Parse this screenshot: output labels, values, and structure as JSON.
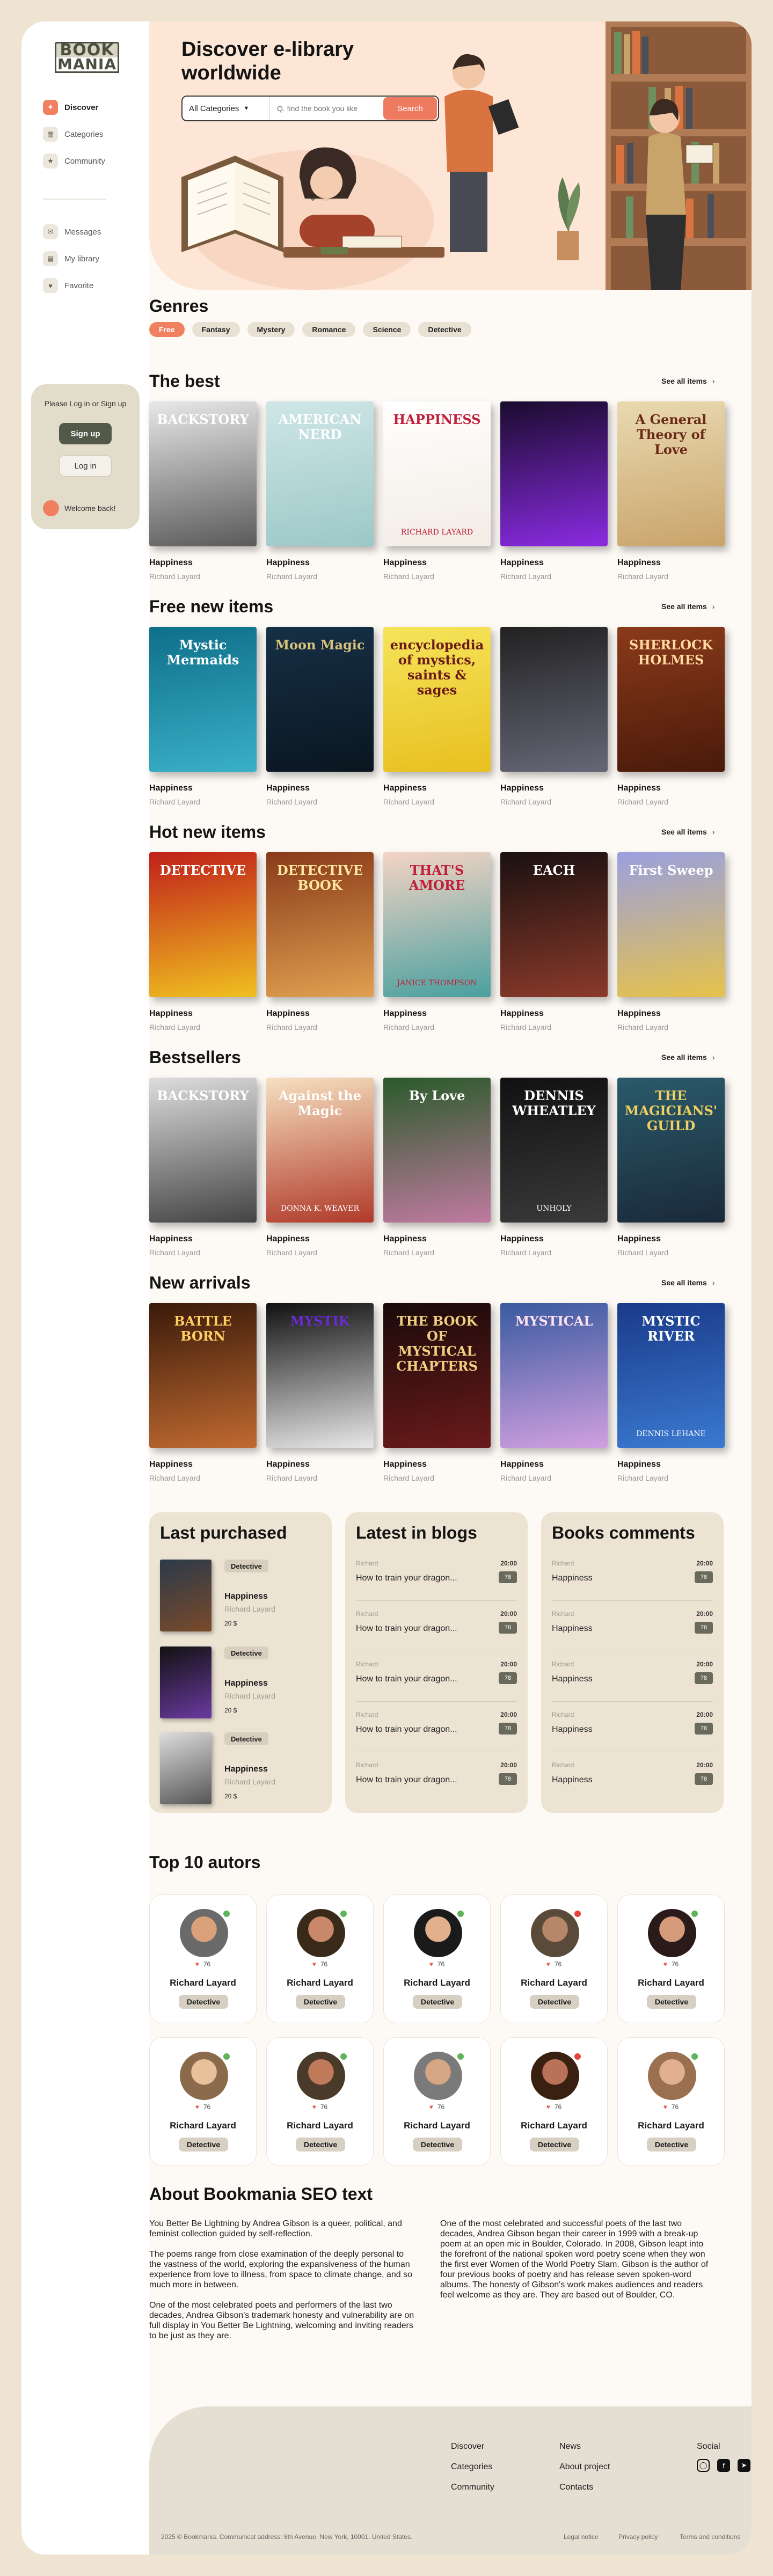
{
  "app": {
    "logo_line1": "BOOK",
    "logo_line2": "MANIA"
  },
  "sidebar": {
    "items": [
      {
        "label": "Discover",
        "icon": "compass-icon"
      },
      {
        "label": "Categories",
        "icon": "grid-icon"
      },
      {
        "label": "Community",
        "icon": "star-icon"
      },
      {
        "label": "Messages",
        "icon": "message-icon"
      },
      {
        "label": "My library",
        "icon": "book-icon"
      },
      {
        "label": "Favorite",
        "icon": "heart-icon"
      }
    ],
    "login": {
      "text": "Please Log in or Sign up",
      "signup": "Sign up",
      "login": "Log in",
      "welcome": "Welcome back!"
    }
  },
  "hero": {
    "title": "Discover e-library worldwide",
    "category": "All Categories",
    "placeholder": "Q. find the book you like",
    "search_button": "Search"
  },
  "genres": {
    "title": "Genres",
    "items": [
      "Free",
      "Fantasy",
      "Mystery",
      "Romance",
      "Science",
      "Detective"
    ]
  },
  "see_all": "See all items",
  "sections": [
    {
      "title": "The best",
      "books": [
        {
          "cover_title": "BACKSTORY",
          "cover_author": "",
          "title": "Happiness",
          "author": "Richard Layard"
        },
        {
          "cover_title": "AMERICAN NERD",
          "cover_author": "",
          "title": "Happiness",
          "author": "Richard Layard"
        },
        {
          "cover_title": "HAPPINESS",
          "cover_author": "RICHARD LAYARD",
          "title": "Happiness",
          "author": "Richard Layard"
        },
        {
          "cover_title": "",
          "cover_author": "",
          "title": "Happiness",
          "author": "Richard Layard"
        },
        {
          "cover_title": "A General Theory of Love",
          "cover_author": "",
          "title": "Happiness",
          "author": "Richard Layard"
        }
      ]
    },
    {
      "title": "Free new items",
      "books": [
        {
          "cover_title": "Mystic Mermaids",
          "cover_author": "",
          "title": "Happiness",
          "author": "Richard Layard"
        },
        {
          "cover_title": "Moon Magic",
          "cover_author": "",
          "title": "Happiness",
          "author": "Richard Layard"
        },
        {
          "cover_title": "encyclopedia of mystics, saints & sages",
          "cover_author": "",
          "title": "Happiness",
          "author": "Richard Layard"
        },
        {
          "cover_title": "",
          "cover_author": "",
          "title": "Happiness",
          "author": "Richard Layard"
        },
        {
          "cover_title": "SHERLOCK HOLMES",
          "cover_author": "",
          "title": "Happiness",
          "author": "Richard Layard"
        }
      ]
    },
    {
      "title": "Hot new items",
      "books": [
        {
          "cover_title": "DETECTIVE",
          "cover_author": "",
          "title": "Happiness",
          "author": "Richard Layard"
        },
        {
          "cover_title": "DETECTIVE BOOK",
          "cover_author": "",
          "title": "Happiness",
          "author": "Richard Layard"
        },
        {
          "cover_title": "THAT'S AMORE",
          "cover_author": "JANICE THOMPSON",
          "title": "Happiness",
          "author": "Richard Layard"
        },
        {
          "cover_title": "EACH",
          "cover_author": "",
          "title": "Happiness",
          "author": "Richard Layard"
        },
        {
          "cover_title": "First Sweep",
          "cover_author": "",
          "title": "Happiness",
          "author": "Richard Layard"
        }
      ]
    },
    {
      "title": "Bestsellers",
      "books": [
        {
          "cover_title": "BACKSTORY",
          "cover_author": "",
          "title": "Happiness",
          "author": "Richard Layard"
        },
        {
          "cover_title": "Against the Magic",
          "cover_author": "DONNA K. WEAVER",
          "title": "Happiness",
          "author": "Richard Layard"
        },
        {
          "cover_title": "By Love",
          "cover_author": "",
          "title": "Happiness",
          "author": "Richard Layard"
        },
        {
          "cover_title": "DENNIS WHEATLEY",
          "cover_author": "UNHOLY",
          "title": "Happiness",
          "author": "Richard Layard"
        },
        {
          "cover_title": "THE MAGICIANS' GUILD",
          "cover_author": "",
          "title": "Happiness",
          "author": "Richard Layard"
        }
      ]
    },
    {
      "title": "New arrivals",
      "books": [
        {
          "cover_title": "BATTLE BORN",
          "cover_author": "",
          "title": "Happiness",
          "author": "Richard Layard"
        },
        {
          "cover_title": "MYSTIK",
          "cover_author": "",
          "title": "Happiness",
          "author": "Richard Layard"
        },
        {
          "cover_title": "THE BOOK OF MYSTICAL CHAPTERS",
          "cover_author": "",
          "title": "Happiness",
          "author": "Richard Layard"
        },
        {
          "cover_title": "MYSTICAL",
          "cover_author": "",
          "title": "Happiness",
          "author": "Richard Layard"
        },
        {
          "cover_title": "MYSTIC RIVER",
          "cover_author": "DENNIS LEHANE",
          "title": "Happiness",
          "author": "Richard Layard"
        }
      ]
    }
  ],
  "last_purchased": {
    "title": "Last purchased",
    "items": [
      {
        "tag": "Detective",
        "title": "Happiness",
        "author": "Richard Layard",
        "price": "20 $"
      },
      {
        "tag": "Detective",
        "title": "Happiness",
        "author": "Richard Layard",
        "price": "20 $"
      },
      {
        "tag": "Detective",
        "title": "Happiness",
        "author": "Richard Layard",
        "price": "20 $"
      }
    ]
  },
  "blogs": {
    "title": "Latest in blogs",
    "items": [
      {
        "user": "Richard",
        "time": "20:00",
        "text": "How to train your dragon...",
        "count": "78"
      },
      {
        "user": "Richard",
        "time": "20:00",
        "text": "How to train your dragon...",
        "count": "78"
      },
      {
        "user": "Richard",
        "time": "20:00",
        "text": "How to train your dragon...",
        "count": "78"
      },
      {
        "user": "Richard",
        "time": "20:00",
        "text": "How to train your dragon...",
        "count": "78"
      },
      {
        "user": "Richard",
        "time": "20:00",
        "text": "How to train your dragon...",
        "count": "78"
      }
    ]
  },
  "comments": {
    "title": "Books comments",
    "items": [
      {
        "user": "Richard",
        "time": "20:00",
        "text": "Happiness",
        "count": "78"
      },
      {
        "user": "Richard",
        "time": "20:00",
        "text": "Happiness",
        "count": "78"
      },
      {
        "user": "Richard",
        "time": "20:00",
        "text": "Happiness",
        "count": "78"
      },
      {
        "user": "Richard",
        "time": "20:00",
        "text": "Happiness",
        "count": "78"
      },
      {
        "user": "Richard",
        "time": "20:00",
        "text": "Happiness",
        "count": "78"
      }
    ]
  },
  "authors": {
    "title": "Top 10 autors",
    "items": [
      {
        "name": "Richard Layard",
        "likes": "76",
        "tag": "Detective",
        "status": "#5fb35a"
      },
      {
        "name": "Richard Layard",
        "likes": "76",
        "tag": "Detective",
        "status": "#5fb35a"
      },
      {
        "name": "Richard Layard",
        "likes": "76",
        "tag": "Detective",
        "status": "#5fb35a"
      },
      {
        "name": "Richard Layard",
        "likes": "76",
        "tag": "Detective",
        "status": "#e5443a"
      },
      {
        "name": "Richard Layard",
        "likes": "76",
        "tag": "Detective",
        "status": "#5fb35a"
      },
      {
        "name": "Richard Layard",
        "likes": "76",
        "tag": "Detective",
        "status": "#5fb35a"
      },
      {
        "name": "Richard Layard",
        "likes": "76",
        "tag": "Detective",
        "status": "#5fb35a"
      },
      {
        "name": "Richard Layard",
        "likes": "76",
        "tag": "Detective",
        "status": "#5fb35a"
      },
      {
        "name": "Richard Layard",
        "likes": "76",
        "tag": "Detective",
        "status": "#e5443a"
      },
      {
        "name": "Richard Layard",
        "likes": "76",
        "tag": "Detective",
        "status": "#5fb35a"
      }
    ]
  },
  "about": {
    "title": "About Bookmania SEO text",
    "left": [
      "You Better Be Lightning by Andrea Gibson is a queer, political, and feminist collection guided by self-reflection.",
      "The poems range from close examination of the deeply personal to the vastness of the world, exploring the expansiveness of the human experience from love to illness, from space to climate change, and so much more in between.",
      "One of the most celebrated poets and performers of the last two decades, Andrea Gibson's trademark honesty and vulnerability are on full display in You Better Be Lightning, welcoming and inviting readers to be just as they are."
    ],
    "right": [
      "One of the most celebrated and successful poets of the last two decades, Andrea Gibson began their career in 1999 with a break-up poem at an open mic in Boulder, Colorado. In 2008, Gibson leapt into the forefront of the national spoken word poetry scene when they won the first ever Women of the World Poetry Slam. Gibson is the author of four previous books of poetry and has release seven spoken-word albums. The honesty of Gibson's work makes audiences and readers feel welcome as they are. They are based out of Boulder, CO."
    ]
  },
  "footer": {
    "col1": [
      "Discover",
      "Categories",
      "Community"
    ],
    "col2": [
      "News",
      "About project",
      "Contacts"
    ],
    "social_title": "Social",
    "copyright": "2025 © Bookmania. Communicat address: 8th Avenue, New York, 10001. United States.",
    "legal": [
      "Legal notice",
      "Privacy policy",
      "Terms and conditions"
    ]
  },
  "colors": {
    "accent": "#f08060",
    "dark": "#525948",
    "panel": "#ece3d3",
    "hero": "#fde6d6"
  }
}
